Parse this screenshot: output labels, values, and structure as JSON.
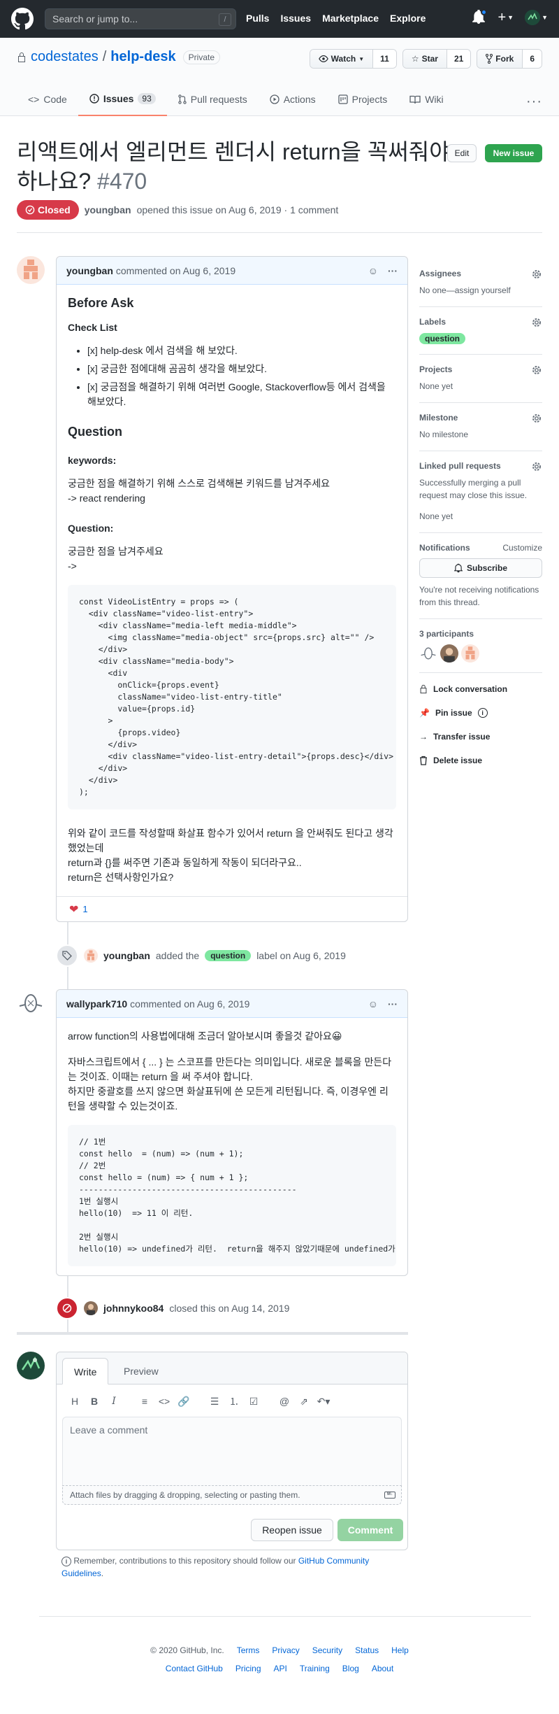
{
  "header": {
    "search_placeholder": "Search or jump to...",
    "search_shortcut": "/",
    "nav": [
      "Pulls",
      "Issues",
      "Marketplace",
      "Explore"
    ]
  },
  "repo": {
    "owner": "codestates",
    "separator": "/",
    "name": "help-desk",
    "visibility": "Private",
    "watch_label": "Watch",
    "watch_count": "11",
    "star_label": "Star",
    "star_count": "21",
    "fork_label": "Fork",
    "fork_count": "6",
    "tabs": [
      {
        "label": "Code"
      },
      {
        "label": "Issues",
        "count": "93"
      },
      {
        "label": "Pull requests"
      },
      {
        "label": "Actions"
      },
      {
        "label": "Projects"
      },
      {
        "label": "Wiki"
      }
    ]
  },
  "issue": {
    "title": "리액트에서 엘리먼트 렌더시 return을 꼭써줘야하나요?",
    "number": "#470",
    "edit_label": "Edit",
    "new_issue_label": "New issue",
    "state": "Closed",
    "author": "youngban",
    "meta": "opened this issue on Aug 6, 2019 · 1 comment"
  },
  "comment1": {
    "author": "youngban",
    "meta": "commented on Aug 6, 2019",
    "h_before": "Before Ask",
    "h_checklist": "Check List",
    "checklist": [
      "[x] help-desk 에서 검색을 해 보았다.",
      "[x] 궁금한 점에대해 곰곰히 생각을 해보았다.",
      "[x] 궁금점을 해결하기 위해 여러번 Google, Stackoverflow등 에서 검색을 해보았다."
    ],
    "h_question": "Question",
    "h_keywords": "keywords:",
    "keywords_text1": "궁금한 점을 해결하기 위해 스스로 검색해본 키워드를 남겨주세요",
    "keywords_text2": "-> react rendering",
    "h_question2": "Question:",
    "question_text1": "궁금한 점을 남겨주세요",
    "question_text2": "->",
    "code": "const VideoListEntry = props => (\n  <div className=\"video-list-entry\">\n    <div className=\"media-left media-middle\">\n      <img className=\"media-object\" src={props.src} alt=\"\" />\n    </div>\n    <div className=\"media-body\">\n      <div\n        onClick={props.event}\n        className=\"video-list-entry-title\"\n        value={props.id}\n      >\n        {props.video}\n      </div>\n      <div className=\"video-list-entry-detail\">{props.desc}</div>\n    </div>\n  </div>\n);",
    "after1": "위와 같이 코드를 작성할때 화살표 함수가 있어서 return 을 안써줘도 된다고 생각했었는데",
    "after2": "return과 {}를 써주면 기존과 동일하게 작동이 되더라구요..",
    "after3": "return은 선택사항인가요?",
    "reaction_count": "1"
  },
  "label_event": {
    "actor": "youngban",
    "text1": "added the",
    "label": "question",
    "text2": "label on Aug 6, 2019"
  },
  "comment2": {
    "author": "wallypark710",
    "meta": "commented on Aug 6, 2019",
    "p1": "arrow function의 사용법에대해 조금더 알아보시며 좋을것 같아요😀",
    "p2a": "자바스크립트에서 { ... } 는 스코프를 만든다는 의미입니다. 새로운 블록을 만든다는 것이죠. 이때는 return 을 써 주셔야 합니다.",
    "p2b": "하지만 중괄호를 쓰지 않으면 화살표뒤에 쓴 모든게 리턴됩니다. 즉, 이경우엔 리턴을 생략할 수 있는것이죠.",
    "code": "// 1번\nconst hello  = (num) => (num + 1);\n// 2번\nconst hello = (num) => { num + 1 };\n---------------------------------------------\n1번 실행시\nhello(10)  => 11 이 리턴.\n\n2번 실행시\nhello(10) => undefined가 리턴.  return을 해주지 않았기때문에 undefined가 리턴"
  },
  "close_event": {
    "actor": "johnnykoo84",
    "text": "closed this on Aug 14, 2019"
  },
  "new_comment": {
    "tab_write": "Write",
    "tab_preview": "Preview",
    "placeholder": "Leave a comment",
    "attach": "Attach files by dragging & dropping, selecting or pasting them.",
    "reopen": "Reopen issue",
    "submit": "Comment",
    "reminder_prefix": "Remember, contributions to this repository should follow our",
    "reminder_link": "GitHub Community Guidelines",
    "reminder_suffix": "."
  },
  "sidebar": {
    "assignees_title": "Assignees",
    "assignees_value": "No one—assign yourself",
    "labels_title": "Labels",
    "labels_value": "question",
    "projects_title": "Projects",
    "projects_value": "None yet",
    "milestone_title": "Milestone",
    "milestone_value": "No milestone",
    "linked_title": "Linked pull requests",
    "linked_desc": "Successfully merging a pull request may close this issue.",
    "linked_value": "None yet",
    "notifications_title": "Notifications",
    "customize": "Customize",
    "subscribe": "Subscribe",
    "notif_desc": "You're not receiving notifications from this thread.",
    "participants_title": "3 participants",
    "lock": "Lock conversation",
    "pin": "Pin issue",
    "transfer": "Transfer issue",
    "delete": "Delete issue"
  },
  "footer": {
    "copyright": "© 2020 GitHub, Inc.",
    "links1": [
      "Terms",
      "Privacy",
      "Security",
      "Status",
      "Help"
    ],
    "links2": [
      "Contact GitHub",
      "Pricing",
      "API",
      "Training",
      "Blog",
      "About"
    ]
  },
  "colors": {
    "closed": "#d73a49",
    "primary": "#2ea44f",
    "label": "#7ee7a0",
    "link": "#0366d6"
  }
}
